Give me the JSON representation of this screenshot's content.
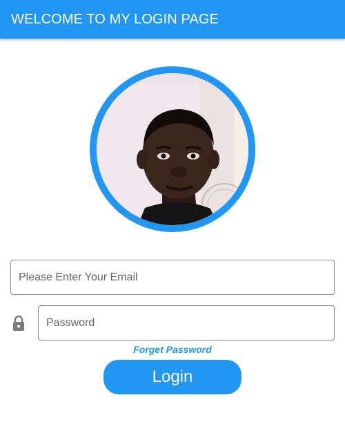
{
  "appbar": {
    "title": "WELCOME TO MY LOGIN PAGE",
    "color": "#2196f3"
  },
  "profile": {
    "icon": "avatar-photo",
    "ring_color": "#2196f3"
  },
  "form": {
    "email": {
      "placeholder": "Please Enter Your Email",
      "value": ""
    },
    "password": {
      "icon": "lock-icon",
      "placeholder": "Password",
      "value": ""
    },
    "forget_password_label": "Forget Password",
    "login_label": "Login"
  }
}
